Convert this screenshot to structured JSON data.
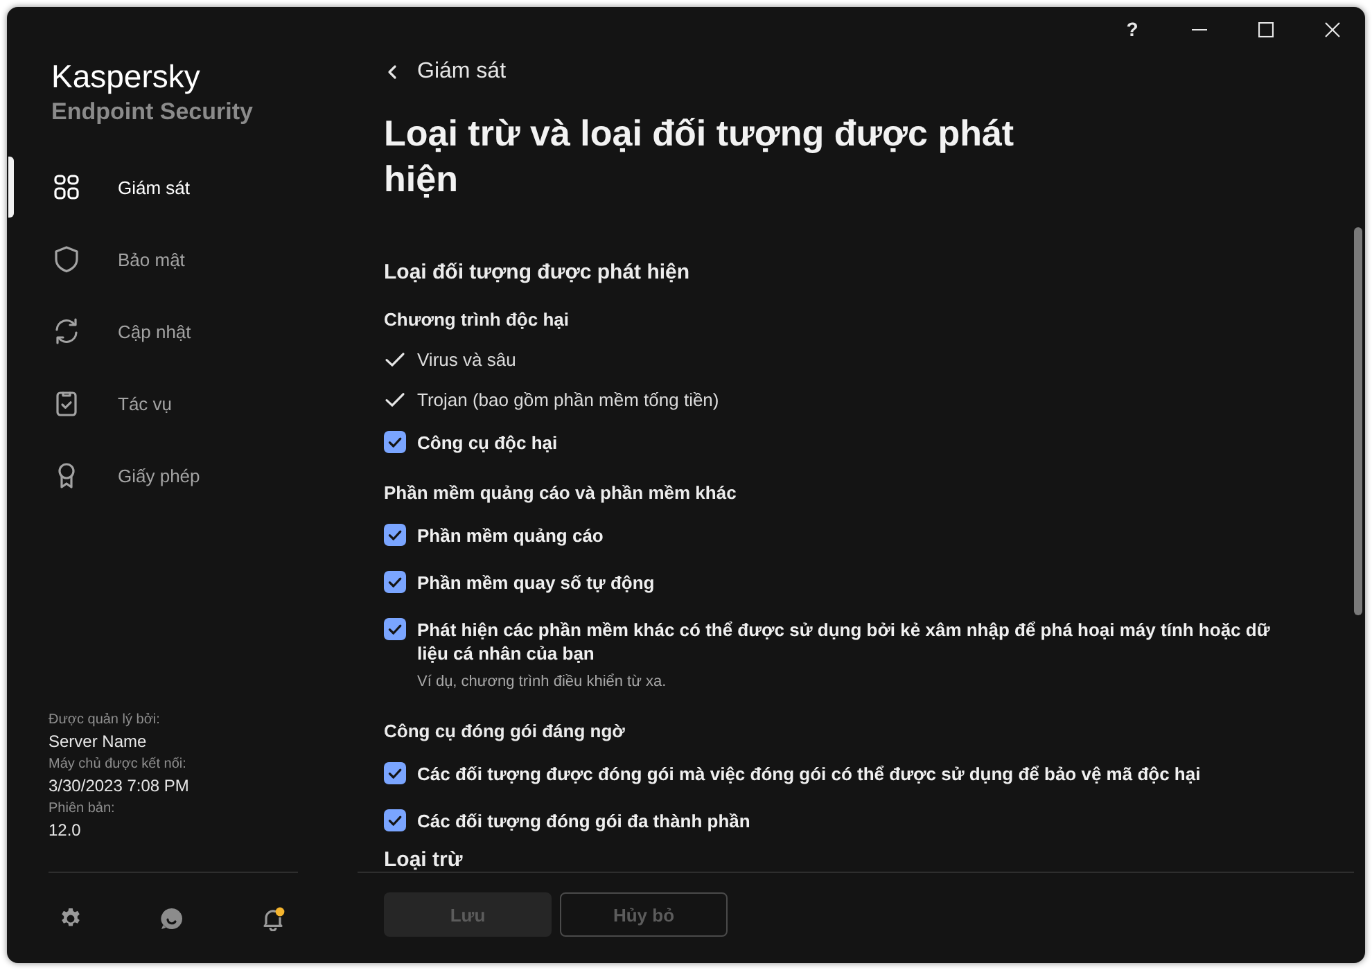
{
  "window": {
    "help": "?"
  },
  "sidebar": {
    "brand": "Kaspersky",
    "product": "Endpoint Security",
    "items": [
      {
        "label": "Giám sát",
        "kind": "monitoring",
        "selected": true
      },
      {
        "label": "Bảo mật",
        "kind": "protection",
        "selected": false
      },
      {
        "label": "Cập nhật",
        "kind": "update",
        "selected": false
      },
      {
        "label": "Tác vụ",
        "kind": "tasks",
        "selected": false
      },
      {
        "label": "Giấy phép",
        "kind": "license",
        "selected": false
      }
    ],
    "info": [
      {
        "label": "Được quản lý bởi:",
        "value": "Server Name"
      },
      {
        "label": "Máy chủ được kết nối:",
        "value": "3/30/2023 7:08 PM"
      },
      {
        "label": "Phiên bản:",
        "value": "12.0"
      }
    ],
    "footer_icons": [
      {
        "kind": "settings"
      },
      {
        "kind": "support"
      },
      {
        "kind": "notifications",
        "badge": true
      }
    ]
  },
  "page": {
    "back": "Giám sát",
    "title": "Loại trừ và loại đối tượng được phát hiện",
    "section": "Loại đối tượng được phát hiện",
    "groups": [
      {
        "title": "Chương trình độc hại",
        "items": [
          {
            "label": "Virus và sâu",
            "kind": "fixed",
            "checked": true
          },
          {
            "label": "Trojan (bao gồm phần mềm tống tiền)",
            "kind": "fixed",
            "checked": true
          },
          {
            "label": "Công cụ độc hại",
            "kind": "checkbox",
            "checked": true
          }
        ]
      },
      {
        "title": "Phần mềm quảng cáo và phần mềm khác",
        "items": [
          {
            "label": "Phần mềm quảng cáo",
            "kind": "checkbox",
            "checked": true
          },
          {
            "label": "Phần mềm quay số tự động",
            "kind": "checkbox",
            "checked": true
          },
          {
            "label": "Phát hiện các phần mềm khác có thể được sử dụng bởi kẻ xâm nhập để phá hoại máy tính hoặc dữ liệu cá nhân của bạn",
            "kind": "checkbox",
            "checked": true,
            "hint": "Ví dụ, chương trình điều khiển từ xa."
          }
        ]
      },
      {
        "title": "Công cụ đóng gói đáng ngờ",
        "items": [
          {
            "label": "Các đối tượng được đóng gói mà việc đóng gói có thể được sử dụng để bảo vệ mã độc hại",
            "kind": "checkbox",
            "checked": true
          },
          {
            "label": "Các đối tượng đóng gói đa thành phần",
            "kind": "checkbox",
            "checked": true
          }
        ]
      }
    ],
    "next_section": "Loại trừ"
  },
  "footer": {
    "buttons": [
      {
        "label": "Lưu",
        "kind": "primary",
        "disabled": true
      },
      {
        "label": "Hủy bỏ",
        "kind": "secondary",
        "disabled": true
      }
    ]
  }
}
